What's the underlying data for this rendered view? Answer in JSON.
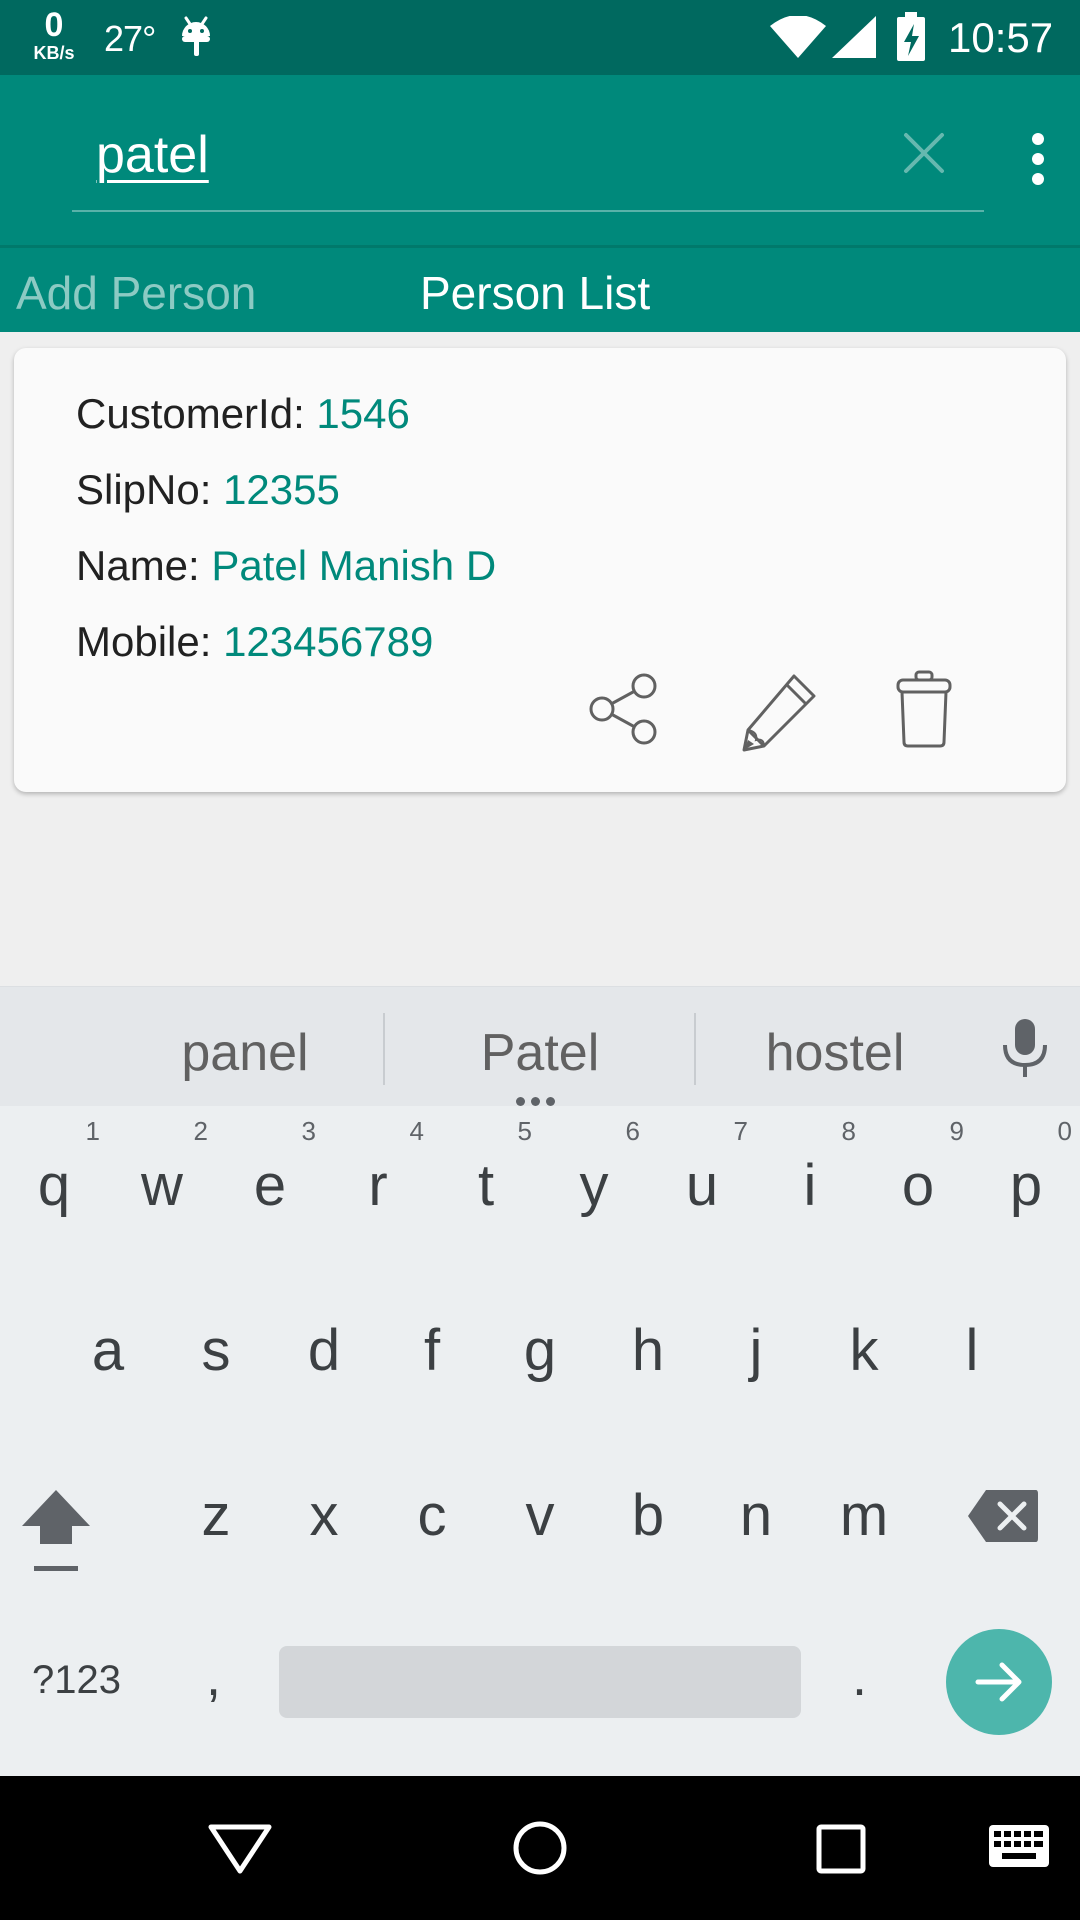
{
  "status_bar": {
    "net_speed": "0",
    "net_unit": "KB/s",
    "temperature": "27°",
    "time": "10:57",
    "icons": [
      "android-icon",
      "wifi-icon",
      "signal-icon",
      "battery-charging-icon"
    ]
  },
  "search": {
    "query": "patel"
  },
  "tabs": [
    {
      "label": "Add Person",
      "active": false
    },
    {
      "label": "Person List",
      "active": true
    }
  ],
  "card": {
    "customer_id": {
      "label": "CustomerId:",
      "value": "1546"
    },
    "slip_no": {
      "label": "SlipNo:",
      "value": "12355"
    },
    "name": {
      "label": "Name:",
      "value": "Patel Manish D"
    },
    "mobile": {
      "label": "Mobile:",
      "value": "123456789"
    },
    "actions": [
      "share-icon",
      "edit-icon",
      "delete-icon"
    ]
  },
  "keyboard": {
    "suggestions": [
      "panel",
      "Patel",
      "hostel"
    ],
    "row1": [
      {
        "ch": "q",
        "hint": "1"
      },
      {
        "ch": "w",
        "hint": "2"
      },
      {
        "ch": "e",
        "hint": "3"
      },
      {
        "ch": "r",
        "hint": "4"
      },
      {
        "ch": "t",
        "hint": "5"
      },
      {
        "ch": "y",
        "hint": "6"
      },
      {
        "ch": "u",
        "hint": "7"
      },
      {
        "ch": "i",
        "hint": "8"
      },
      {
        "ch": "o",
        "hint": "9"
      },
      {
        "ch": "p",
        "hint": "0"
      }
    ],
    "row2": [
      "a",
      "s",
      "d",
      "f",
      "g",
      "h",
      "j",
      "k",
      "l"
    ],
    "row3": [
      "z",
      "x",
      "c",
      "v",
      "b",
      "n",
      "m"
    ],
    "symbols_label": "?123",
    "comma": ",",
    "period": "."
  },
  "colors": {
    "status_bar": "#00695f",
    "primary": "#00897b",
    "accent_value": "#00897b",
    "enter_key": "#4db6ac"
  }
}
